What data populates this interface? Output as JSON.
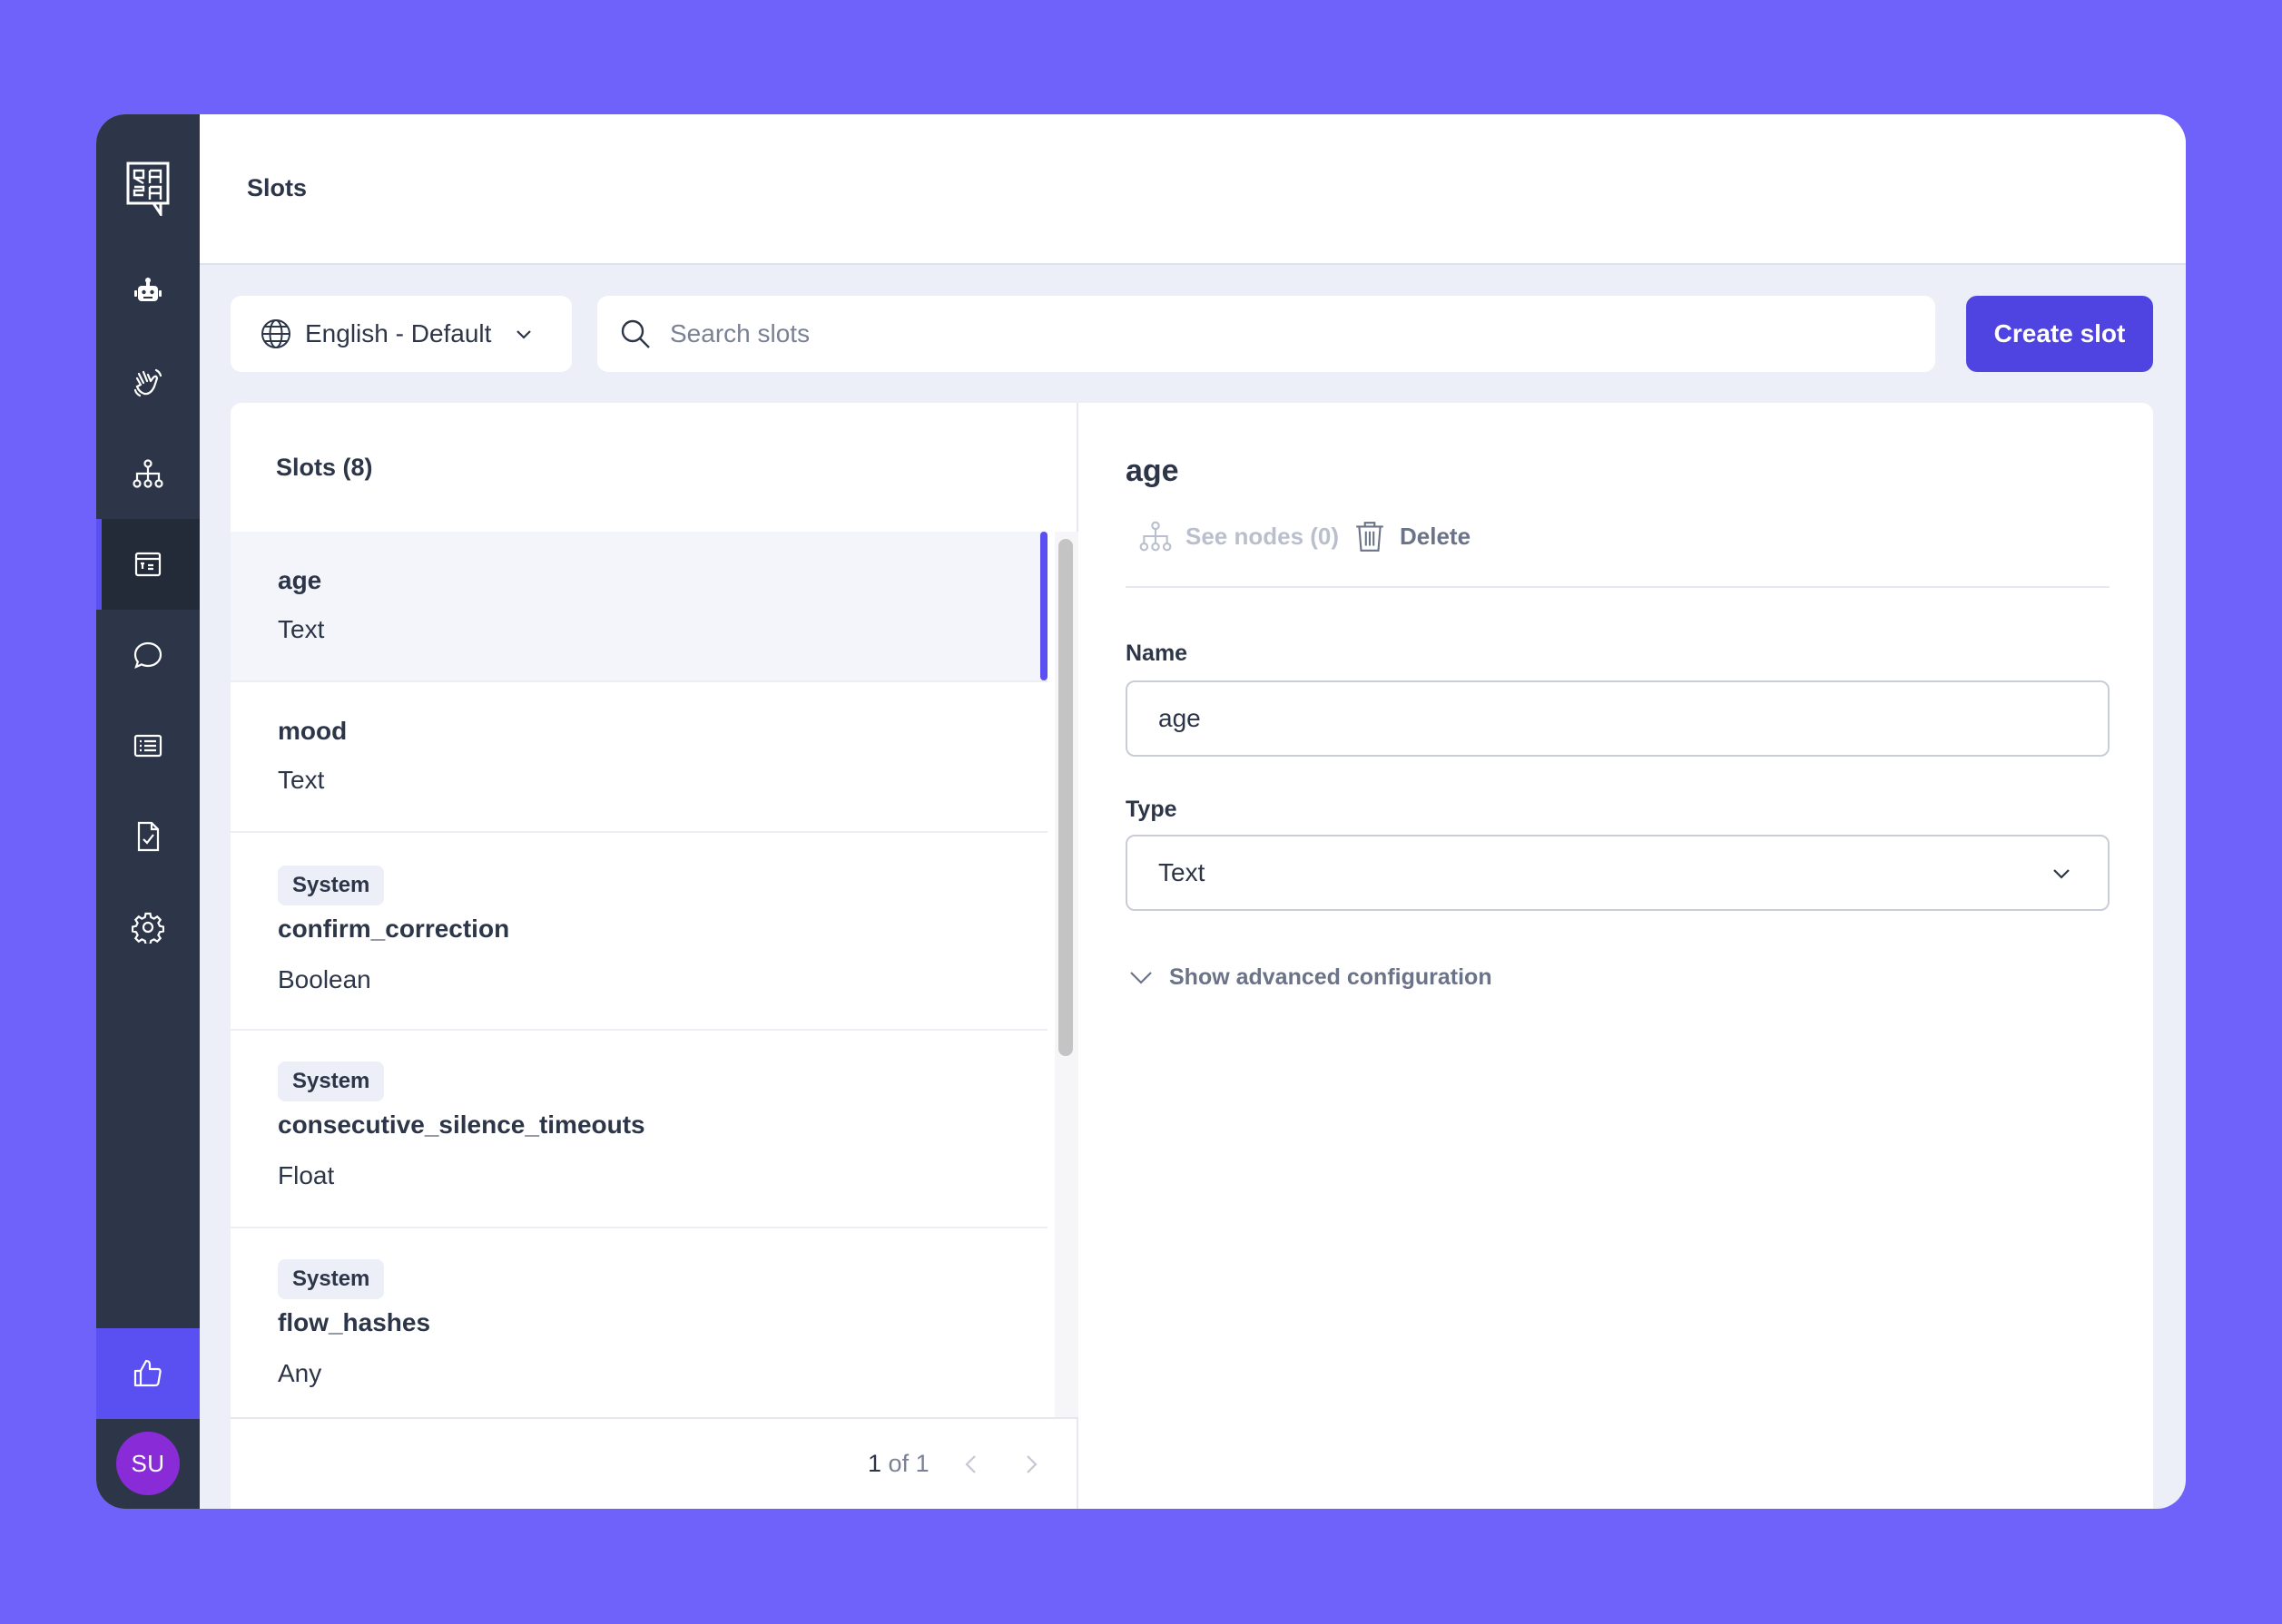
{
  "header": {
    "title": "Slots"
  },
  "toolbar": {
    "language": "English - Default",
    "search_placeholder": "Search slots",
    "create_label": "Create slot"
  },
  "list": {
    "title": "Slots (8)",
    "items": [
      {
        "name": "age",
        "type": "Text",
        "badge": ""
      },
      {
        "name": "mood",
        "type": "Text",
        "badge": ""
      },
      {
        "name": "confirm_correction",
        "type": "Boolean",
        "badge": "System"
      },
      {
        "name": "consecutive_silence_timeouts",
        "type": "Float",
        "badge": "System"
      },
      {
        "name": "flow_hashes",
        "type": "Any",
        "badge": "System"
      }
    ],
    "pager": {
      "current": "1",
      "of_text": "of 1"
    }
  },
  "detail": {
    "title": "age",
    "see_nodes": "See nodes (0)",
    "delete": "Delete",
    "name_label": "Name",
    "name_value": "age",
    "type_label": "Type",
    "type_value": "Text",
    "advanced": "Show advanced configuration"
  },
  "user": {
    "initials": "SU"
  },
  "colors": {
    "background": "#6e62fb",
    "sidebar": "#2d3648",
    "accent": "#4f44e2",
    "avatar": "#8a2bd8"
  },
  "icons": {
    "nav": [
      "bot-icon",
      "hand-wave-icon",
      "flow-tree-icon",
      "slots-icon",
      "chat-bubble-icon",
      "list-icon",
      "document-check-icon",
      "gear-icon"
    ],
    "feedback": "thumbs-up-icon"
  }
}
